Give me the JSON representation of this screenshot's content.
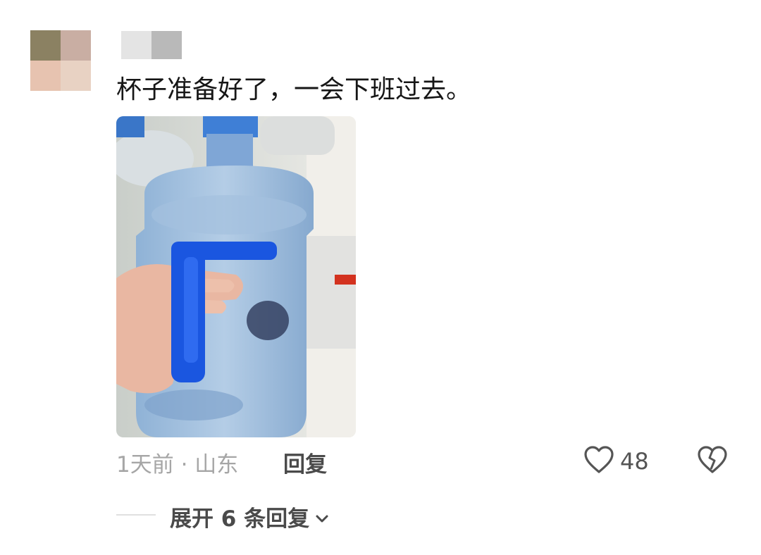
{
  "comment": {
    "text": "杯子准备好了，一会下班过去。",
    "meta": "1天前 · 山东",
    "reply_label": "回复",
    "like_count": "48",
    "expand_label": "展开 6 条回复"
  },
  "icons": {
    "like": "heart-outline-icon",
    "dislike": "broken-heart-icon",
    "expand": "chevron-down-icon"
  },
  "colors": {
    "text_primary": "#161616",
    "text_secondary": "#a6a6a6",
    "handle_blue": "#1a56e0"
  }
}
